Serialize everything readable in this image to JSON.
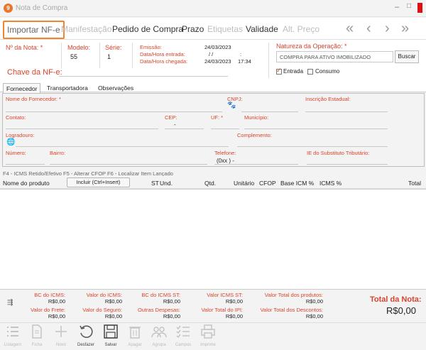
{
  "window": {
    "title": "Nota de Compra",
    "min": "–",
    "max": "□"
  },
  "toolbar": {
    "importar": "Importar NF-e",
    "manifestacao": "Manifestação",
    "pedido": "Pedido de Compra",
    "prazo": "Prazo",
    "etiquetas": "Etiquetas",
    "validade": "Validade",
    "alt_preco": "Alt. Preço",
    "first": "«",
    "prev": "‹",
    "next": "›",
    "last": "»"
  },
  "header": {
    "nota_label": "Nº da Nota: *",
    "modelo_label": "Modelo:",
    "modelo_value": "55",
    "serie_label": "Série:",
    "serie_value": "1",
    "emissao_label": "Emissão:",
    "entrada_label": "Data/Hora entrada:",
    "chegada_label": "Data/Hora chegada:",
    "emissao_value": "24/03/2023",
    "entrada_date": "/ /",
    "entrada_time": ":",
    "chegada_date": "24/03/2023",
    "chegada_time": "17:34",
    "natureza_label": "Natureza da Operação: *",
    "natureza_value": "COMPRA PARA ATIVO IMOBILIZADO",
    "buscar": "Buscar",
    "entrada_chk": "Entrada",
    "consumo_chk": "Consumo",
    "chave_label": "Chave da NF-e:"
  },
  "tabs": [
    "Fornecedor",
    "Transportadora",
    "Observações"
  ],
  "fornecedor": {
    "nome": "Nome do Fornecedor: *",
    "cnpj": "CNPJ:",
    "ie": "Inscrição Estadual:",
    "contato": "Contato:",
    "cep": "CEP:",
    "cep_value": "-",
    "uf": "UF: *",
    "municipio": "Município:",
    "logradouro": "Logradouro:",
    "complemento": "Complemento:",
    "numero": "Número:",
    "bairro": "Bairro:",
    "telefone": "Telefone:",
    "telefone_value": "(0xx )  -",
    "ie_st": "IE do Substituto Tributário:"
  },
  "shortcuts": "F4 - ICMS Retido/Efetivo    F5 - Alterar CFOP    F6 - Localizar Item Lançado",
  "grid": {
    "nome": "Nome do produto",
    "incluir": "Incluir (Ctrl+Insert)",
    "st": "ST",
    "und": "Und.",
    "qtd": "Qtd.",
    "unitario": "Unitário",
    "cfop": "CFOP",
    "base": "Base ICM %",
    "icms": "ICMS %",
    "total": "Total"
  },
  "totals": {
    "bc_icms": "BC do ICMS:",
    "bc_icms_v": "R$0,00",
    "v_icms": "Valor do ICMS:",
    "v_icms_v": "R$0,00",
    "bc_st": "BC do ICMS ST:",
    "bc_st_v": "R$0,00",
    "v_st": "Valor ICMS ST:",
    "v_st_v": "R$0,00",
    "v_prod": "Valor Total dos produtos:",
    "v_prod_v": "R$0,00",
    "frete": "Valor do Frete:",
    "frete_v": "R$0,00",
    "seguro": "Valor do Seguro:",
    "seguro_v": "R$0,00",
    "outras": "Outras Despesas:",
    "outras_v": "R$0,00",
    "ipi": "Valor Total do IPI:",
    "ipi_v": "R$0,00",
    "desc": "Valor Total dos Descontos:",
    "desc_v": "R$0,00",
    "total_label": "Total da Nota:",
    "total_value": "R$0,00"
  },
  "bottom": {
    "listagem": "Listagem",
    "ficha": "Ficha",
    "novo": "Novo",
    "desfazer": "Desfazer",
    "salvar": "Salvar",
    "apagar": "Apagar",
    "agrupa": "Agrupa",
    "campos": "Campos",
    "imprime": "Imprime"
  }
}
